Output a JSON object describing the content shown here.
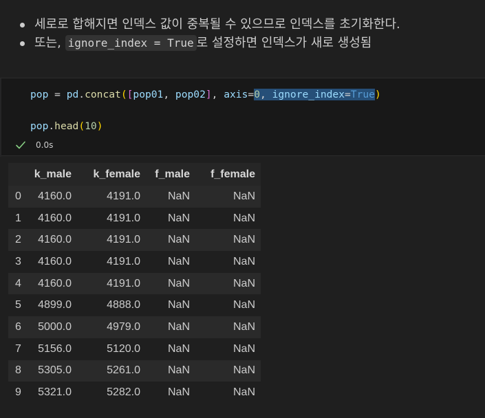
{
  "markdown": {
    "bullet1": "세로로 합해지면 인덱스 값이 중복될 수 있으므로 인덱스를 초기화한다.",
    "bullet2_prefix": "또는, ",
    "bullet2_code": "ignore_index = True",
    "bullet2_suffix": "로 설정하면 인덱스가 새로 생성됨"
  },
  "code": {
    "line1": {
      "var": "pop",
      "assign": " = ",
      "module": "pd",
      "dot": ".",
      "func": "concat",
      "open": "(",
      "lbr": "[",
      "arg1": "pop01",
      "comma1": ", ",
      "arg2": "pop02",
      "rbr": "]",
      "comma2": ", ",
      "kw1": "axis",
      "eq1": "=",
      "val1": "0",
      "comma3": ", ",
      "kw2": "ignore_index",
      "eq2": "=",
      "val2": "True",
      "close": ")"
    },
    "line2": {
      "var": "pop",
      "dot": ".",
      "func": "head",
      "open": "(",
      "arg": "10",
      "close": ")"
    }
  },
  "status": {
    "icon": "check-icon",
    "time": "0.0s",
    "color": "#89d185"
  },
  "table": {
    "columns": [
      "",
      "k_male",
      "k_female",
      "f_male",
      "f_female"
    ],
    "rows": [
      [
        "0",
        "4160.0",
        "4191.0",
        "NaN",
        "NaN"
      ],
      [
        "1",
        "4160.0",
        "4191.0",
        "NaN",
        "NaN"
      ],
      [
        "2",
        "4160.0",
        "4191.0",
        "NaN",
        "NaN"
      ],
      [
        "3",
        "4160.0",
        "4191.0",
        "NaN",
        "NaN"
      ],
      [
        "4",
        "4160.0",
        "4191.0",
        "NaN",
        "NaN"
      ],
      [
        "5",
        "4899.0",
        "4888.0",
        "NaN",
        "NaN"
      ],
      [
        "6",
        "5000.0",
        "4979.0",
        "NaN",
        "NaN"
      ],
      [
        "7",
        "5156.0",
        "5120.0",
        "NaN",
        "NaN"
      ],
      [
        "8",
        "5305.0",
        "5261.0",
        "NaN",
        "NaN"
      ],
      [
        "9",
        "5321.0",
        "5282.0",
        "NaN",
        "NaN"
      ]
    ]
  }
}
